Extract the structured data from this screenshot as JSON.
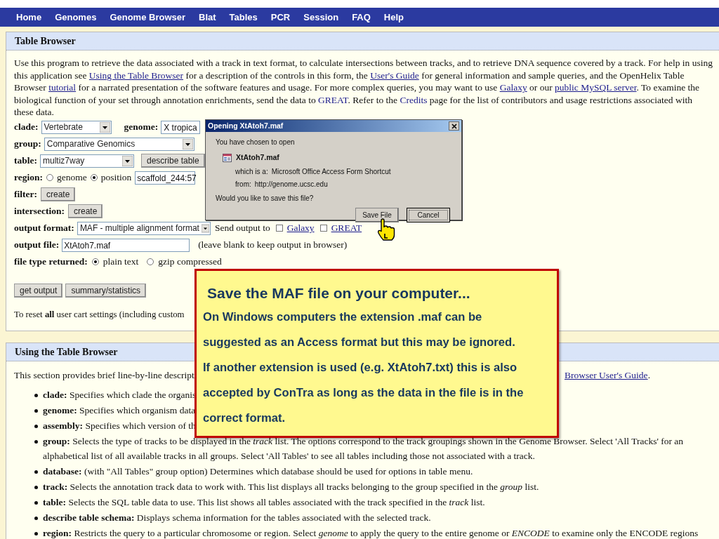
{
  "nav": [
    {
      "label": "Home"
    },
    {
      "label": "Genomes"
    },
    {
      "label": "Genome Browser"
    },
    {
      "label": "Blat"
    },
    {
      "label": "Tables"
    },
    {
      "label": "PCR"
    },
    {
      "label": "Session"
    },
    {
      "label": "FAQ"
    },
    {
      "label": "Help"
    }
  ],
  "table_browser": {
    "title": "Table Browser",
    "intro": [
      {
        "kind": "text",
        "text": "Use this program to retrieve the data associated with a track in text format, to calculate intersections between tracks, and to retrieve DNA sequence covered by a track. For help in using this application see "
      },
      {
        "kind": "link",
        "text": "Using the Table Browser"
      },
      {
        "kind": "text",
        "text": " for a description of the controls in this form, the "
      },
      {
        "kind": "link",
        "text": "User's Guide"
      },
      {
        "kind": "text",
        "text": " for general information and sample queries, and the OpenHelix Table Browser "
      },
      {
        "kind": "link",
        "text": "tutorial"
      },
      {
        "kind": "text",
        "text": " for a narrated presentation of the software features and usage. For more complex queries, you may want to use "
      },
      {
        "kind": "link",
        "text": "Galaxy"
      },
      {
        "kind": "text",
        "text": " or our "
      },
      {
        "kind": "link",
        "text": "public MySQL server"
      },
      {
        "kind": "text",
        "text": ". To examine the biological function of your set through annotation enrichments, send the data to "
      },
      {
        "kind": "plain_link",
        "text": "GREAT"
      },
      {
        "kind": "text",
        "text": ". Refer to the "
      },
      {
        "kind": "plain_link",
        "text": "Credits"
      },
      {
        "kind": "text",
        "text": " page for the list of contributors and usage restrictions associated with these data."
      }
    ],
    "clade": {
      "label": "clade:",
      "value": "Vertebrate"
    },
    "genome": {
      "label": "genome:",
      "value": "X tropica"
    },
    "group": {
      "label": "group:",
      "value": "Comparative Genomics"
    },
    "table": {
      "label": "table:",
      "value": "multiz7way",
      "button": "describe table"
    },
    "region": {
      "label": "region:",
      "options": [
        {
          "label": "genome",
          "selected": false
        },
        {
          "label": "position",
          "selected": true
        }
      ],
      "value": "scaffold_244:57"
    },
    "filter": {
      "label": "filter:",
      "button": "create"
    },
    "intersection": {
      "label": "intersection:",
      "button": "create"
    },
    "output_format": {
      "label": "output format:",
      "value": "MAF - multiple alignment format",
      "send_label": "Send output to",
      "targets": [
        {
          "label": "Galaxy",
          "checked": false
        },
        {
          "label": "GREAT",
          "checked": false
        }
      ]
    },
    "output_file": {
      "label": "output file:",
      "value": "XtAtoh7.maf",
      "hint": "(leave blank to keep output in browser)"
    },
    "file_type": {
      "label": "file type returned:",
      "options": [
        {
          "label": "plain text",
          "selected": true
        },
        {
          "label": "gzip compressed",
          "selected": false
        }
      ]
    },
    "actions": [
      "get output",
      "summary/statistics"
    ],
    "reset_note": "To reset **all** user cart settings (including custom"
  },
  "using": {
    "title": "Using the Table Browser",
    "intro": "This section provides brief line-by-line descript",
    "guide_link": "Browser User's Guide",
    "guide_tail": ".",
    "items": [
      {
        "term": "clade:",
        "text": "Specifies which clade the organis"
      },
      {
        "term": "genome:",
        "text": "Specifies which organism data"
      },
      {
        "term": "assembly:",
        "text": "Specifies which version of th"
      },
      {
        "term": "group:",
        "text": "Selects the type of tracks to be displayed in the *track* list. The options correspond to the track groupings shown in the Genome Browser. Select 'All Tracks' for an alphabetical list of all available tracks in all groups. Select 'All Tables' to see all tables including those not associated with a track."
      },
      {
        "term": "database:",
        "text": "(with \"All Tables\" group option) Determines which database should be used for options in table menu."
      },
      {
        "term": "track:",
        "text": "Selects the annotation track data to work with. This list displays all tracks belonging to the group specified in the *group* list."
      },
      {
        "term": "table:",
        "text": "Selects the SQL table data to use. This list shows all tables associated with the track specified in the *track* list."
      },
      {
        "term": "describe table schema:",
        "text": "Displays schema information for the tables associated with the selected track."
      },
      {
        "term": "region:",
        "text": "Restricts the query to a particular chromosome or region. Select *genome* to apply the query to the entire genome or *ENCODE* to examine only the ENCODE regions"
      }
    ]
  },
  "dialog": {
    "title": "Opening XtAtoh7.maf",
    "prompt": "You have chosen to open",
    "file_name": "XtAtoh7.maf",
    "type_label": "which is a:",
    "type_value": "Microsoft Office Access Form Shortcut",
    "from_label": "from:",
    "from_value": "http://genome.ucsc.edu",
    "question": "Would you like to save this file?",
    "buttons": [
      {
        "label": "Save File",
        "selected": false
      },
      {
        "label": "Cancel",
        "selected": true
      }
    ]
  },
  "callout": {
    "title": "Save the MAF file on your computer...",
    "paragraphs": [
      "On Windows computers the extension .maf can be suggested as an Access format but this may be ignored.",
      "If another extension is used (e.g. XtAtoh7.txt) this is also accepted by ConTra as long as the data in the file is in the correct format."
    ]
  }
}
